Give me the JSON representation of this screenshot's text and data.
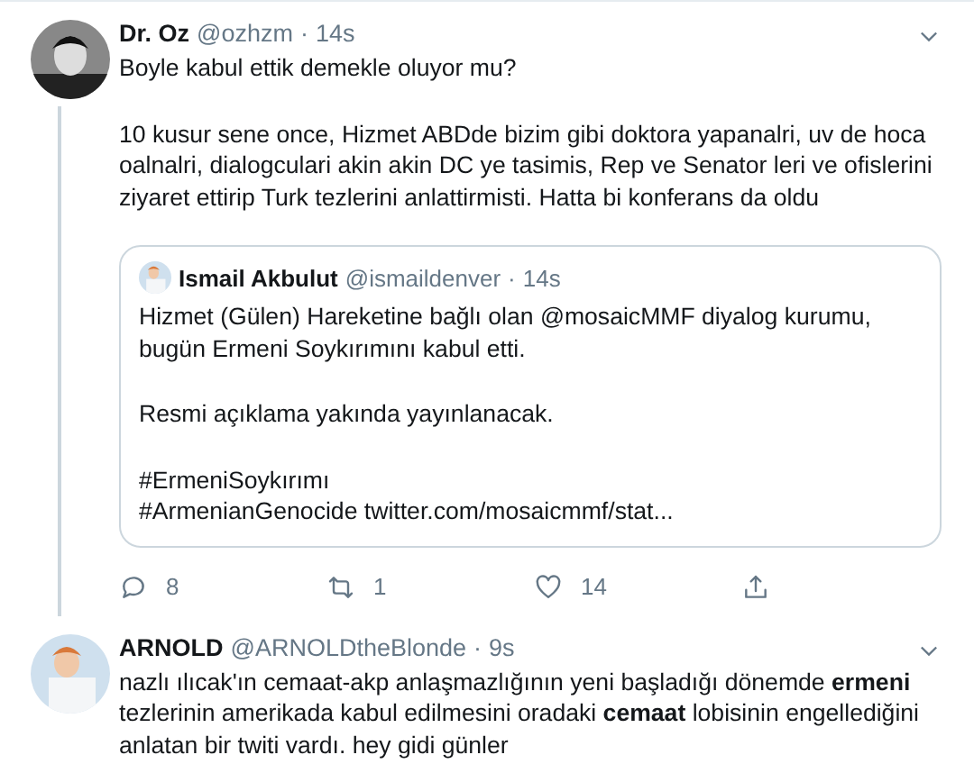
{
  "tweets": [
    {
      "name": "Dr. Oz",
      "handle": "@ozhzm",
      "separator": "·",
      "time": "14s",
      "thread": true,
      "paragraphs": [
        [
          "Boyle kabul ettik demekle oluyor mu?"
        ],
        [
          "10 kusur sene once, Hizmet ABDde bizim gibi doktora yapanalri, uv de hoca",
          "oalnalri, dialogculari akin akin DC ye tasimis, Rep ve Senator leri ve ofislerini",
          "ziyaret ettirip Turk tezlerini anlattirmisti. Hatta bi konferans da oldu"
        ]
      ],
      "quote": {
        "name": "Ismail Akbulut",
        "handle": "@ismaildenver",
        "separator": "·",
        "time": "14s",
        "paragraphs": [
          [
            "Hizmet (Gülen) Hareketine bağlı olan @mosaicMMF diyalog kurumu,",
            "bugün Ermeni Soykırımını kabul etti."
          ],
          [
            "Resmi açıklama yakında yayınlanacak."
          ],
          [
            "#ErmeniSoykırımı",
            "#ArmenianGenocide twitter.com/mosaicmmf/stat..."
          ]
        ]
      },
      "actions": [
        {
          "kind": "reply",
          "count": "8"
        },
        {
          "kind": "retweet",
          "count": "1"
        },
        {
          "kind": "like",
          "count": "14"
        },
        {
          "kind": "share"
        }
      ]
    },
    {
      "name": "ARNOLD",
      "handle": "@ARNOLDtheBlonde",
      "separator": "·",
      "time": "9s",
      "thread": false,
      "paragraphs": [
        [
          "nazlı ılıcak'ın cemaat-akp anlaşmazlığının yeni başladığı dönemde **ermeni**",
          " tezlerinin amerikada kabul edilmesini oradaki **cemaat** lobisinin engellediğini",
          "anlatan bir twiti vardı. hey gidi günler"
        ]
      ]
    }
  ]
}
